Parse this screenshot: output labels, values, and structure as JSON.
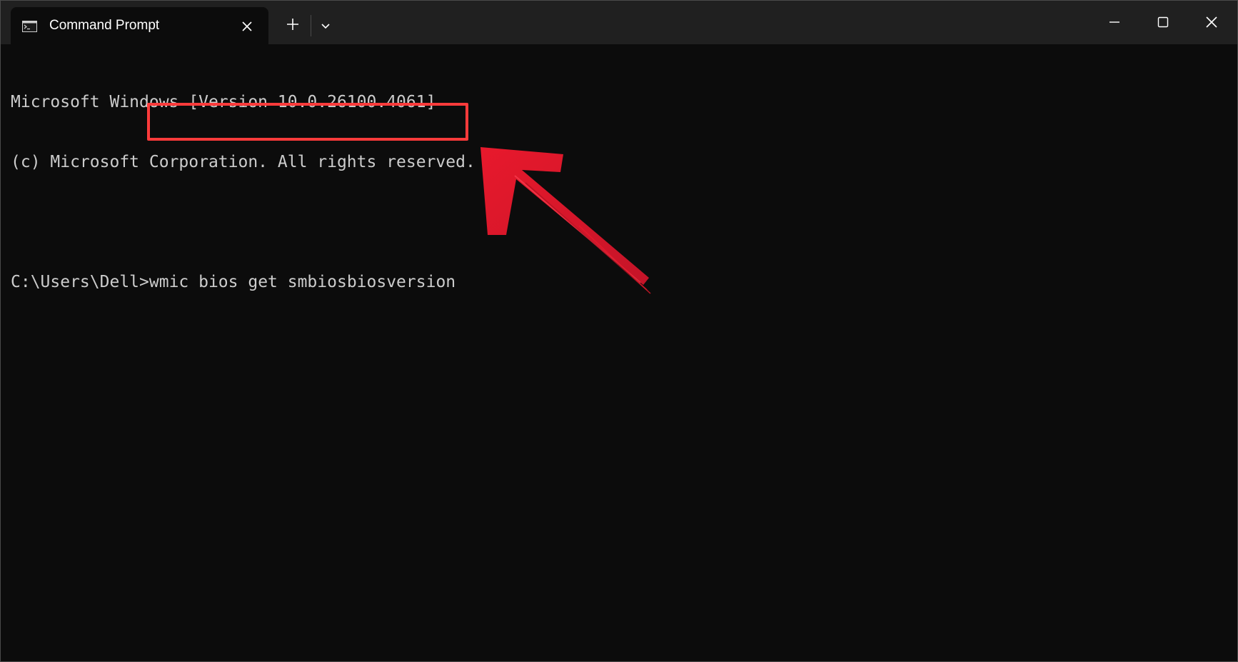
{
  "window": {
    "tab_title": "Command Prompt",
    "icons": {
      "tab_icon": "terminal-icon",
      "tab_close": "close-icon",
      "new_tab": "plus-icon",
      "dropdown": "chevron-down-icon",
      "minimize": "minimize-icon",
      "maximize": "maximize-icon",
      "close": "close-icon"
    }
  },
  "console": {
    "line1": "Microsoft Windows [Version 10.0.26100.4061]",
    "line2": "(c) Microsoft Corporation. All rights reserved.",
    "prompt": "C:\\Users\\Dell>",
    "command": "wmic bios get smbiosbiosversion"
  },
  "annotation": {
    "highlight_color": "#ff3b3b",
    "arrow_color": "#e8192c",
    "icon": "arrow-icon"
  }
}
